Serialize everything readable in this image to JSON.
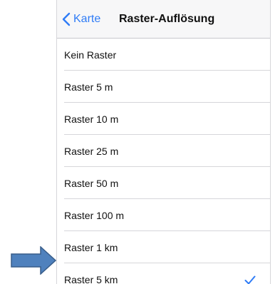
{
  "navbar": {
    "back_label": "Karte",
    "title": "Raster-Auflösung"
  },
  "options": [
    {
      "label": "Kein Raster",
      "selected": false
    },
    {
      "label": "Raster 5 m",
      "selected": false
    },
    {
      "label": "Raster 10 m",
      "selected": false
    },
    {
      "label": "Raster 25 m",
      "selected": false
    },
    {
      "label": "Raster 50 m",
      "selected": false
    },
    {
      "label": "Raster 100 m",
      "selected": false
    },
    {
      "label": "Raster 1 km",
      "selected": false
    },
    {
      "label": "Raster 5 km",
      "selected": true
    }
  ],
  "colors": {
    "accent": "#2f7cf6",
    "annotation_arrow": "#4f81bd",
    "annotation_arrow_border": "#385d8a"
  },
  "icons": {
    "back": "chevron-left-icon",
    "selected": "checkmark-icon",
    "annotation": "right-arrow-icon"
  }
}
